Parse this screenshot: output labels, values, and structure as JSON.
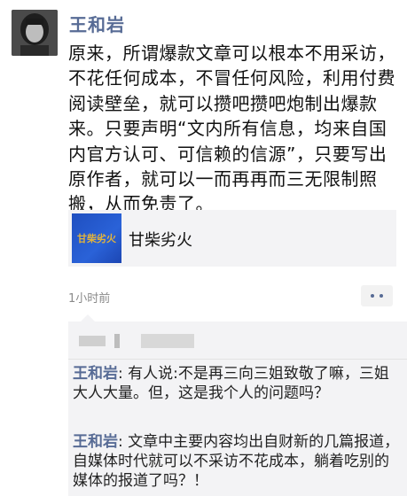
{
  "post": {
    "author": "王和岩",
    "text": "原来，所谓爆款文章可以根本不用采访，不花任何成本，不冒任何风险，利用付费阅读壁垒，就可以攒吧攒吧炮制出爆款来。只要声明“文内所有信息，均来自国内官方认可、可信赖的信源”，只要写出原作者，就可以一而再再而三无限制照搬，从而免责了。",
    "link": {
      "thumb_text": "甘柴劣火",
      "title": "甘柴劣火"
    },
    "time": "1小时前",
    "more_icon": "ellipsis-icon"
  },
  "comments": [
    {
      "author": "王和岩",
      "separator": ": ",
      "text": "有人说:不是再三向三姐致敬了嘛，三姐大人大量。但，这是我个人的问题吗？"
    },
    {
      "author": "王和岩",
      "separator": ": ",
      "text": "文章中主要内容均出自财新的几篇报道，自媒体时代就可以不采访不花成本，躺着吃别的媒体的报道了吗？！"
    }
  ],
  "colors": {
    "author_link": "#576b95",
    "comment_bg": "#f3f3f5",
    "thumb_bg": "#2a62d8",
    "thumb_text": "#e3b43c"
  }
}
